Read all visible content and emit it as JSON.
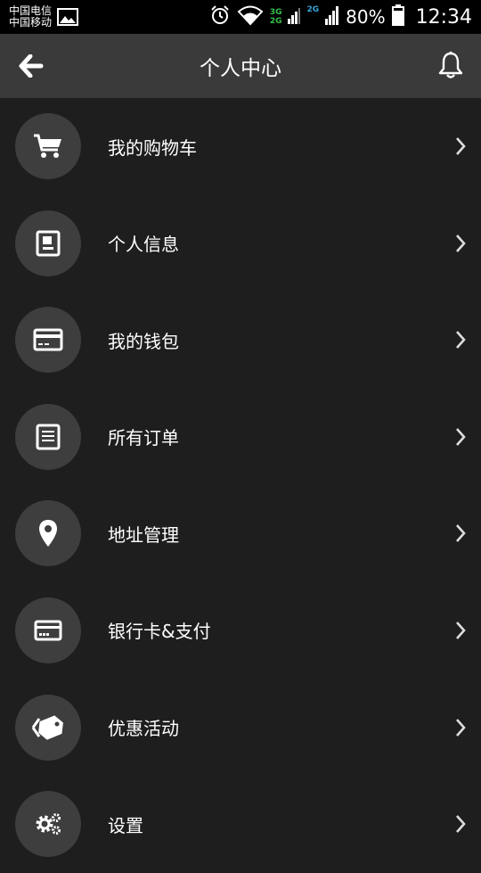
{
  "status_bar": {
    "carrier_1": "中国电信",
    "carrier_2": "中国移动",
    "net_3g": "3G",
    "net_2g_a": "2G",
    "net_2g_b": "2G",
    "battery": "80%",
    "time": "12:34"
  },
  "header": {
    "title": "个人中心"
  },
  "menu": {
    "items": [
      {
        "label": "我的购物车",
        "icon": "cart-icon"
      },
      {
        "label": "个人信息",
        "icon": "profile-card-icon"
      },
      {
        "label": "我的钱包",
        "icon": "wallet-icon"
      },
      {
        "label": "所有订单",
        "icon": "orders-icon"
      },
      {
        "label": "地址管理",
        "icon": "location-pin-icon"
      },
      {
        "label": "银行卡&支付",
        "icon": "bank-card-icon"
      },
      {
        "label": "优惠活动",
        "icon": "tag-icon"
      },
      {
        "label": "设置",
        "icon": "gear-icon"
      }
    ]
  },
  "colors": {
    "background": "#1e1e1e",
    "header": "#3a3a3a",
    "icon_circle": "#3e3e3e",
    "text": "#ffffff"
  }
}
